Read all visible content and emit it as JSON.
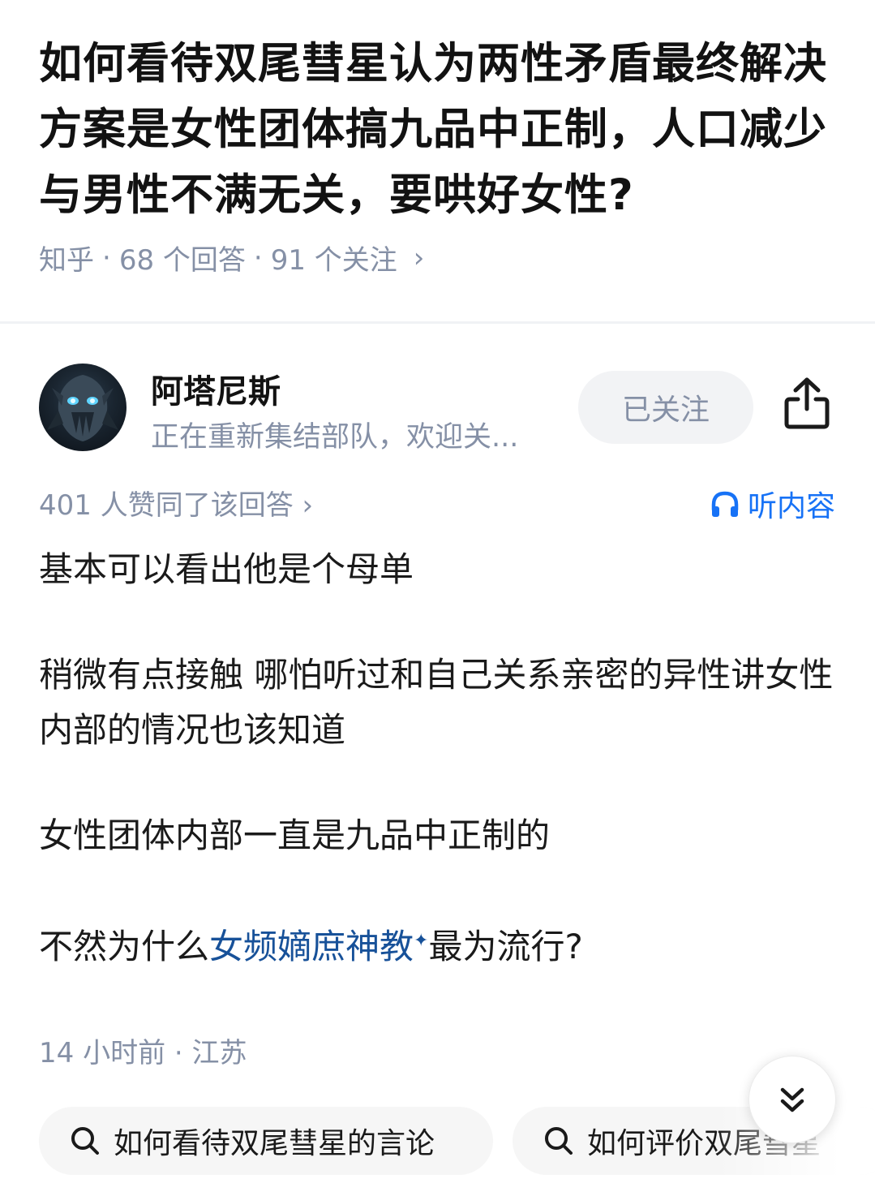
{
  "question": {
    "title": "如何看待双尾彗星认为两性矛盾最终解决方案是女性团体搞九品中正制，人口减少与男性不满无关，要哄好女性?",
    "source": "知乎",
    "answers_count": "68 个回答",
    "followers_count": "91 个关注",
    "separator": "·",
    "chevron": "›"
  },
  "author": {
    "name": "阿塔尼斯",
    "bio": "正在重新集结部队，欢迎关...",
    "follow_label": "已关注"
  },
  "stats": {
    "votes_text": "401 人赞同了该回答 ›",
    "listen_label": "听内容"
  },
  "answer": {
    "p1": "基本可以看出他是个母单",
    "p2": "稍微有点接触 哪怕听过和自己关系亲密的异性讲女性内部的情况也该知道",
    "p3": "女性团体内部一直是九品中正制的",
    "p4_before": "不然为什么",
    "p4_link": "女频嫡庶神教",
    "p4_after": "最为流行?"
  },
  "meta": {
    "timestamp": "14 小时前 · 江苏"
  },
  "related_searches": [
    {
      "label": "如何看待双尾彗星的言论"
    },
    {
      "label": "如何评价双尾彗星"
    }
  ],
  "icons": {
    "share": "share-icon",
    "headphones": "headphones-icon",
    "scroll_down": "double-chevron-down-icon",
    "search": "search-icon"
  },
  "colors": {
    "accent_blue": "#1772f6",
    "link_blue": "#175199",
    "meta_gray": "#8590a6"
  }
}
